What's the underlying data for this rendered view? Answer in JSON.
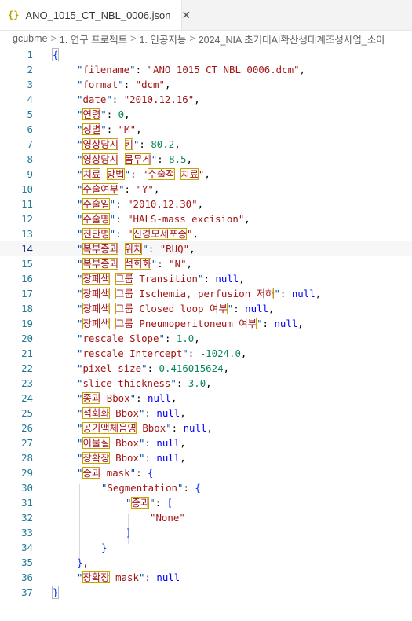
{
  "tab": {
    "icon": "{}",
    "title": "ANO_1015_CT_NBL_0006.json",
    "close": "✕"
  },
  "breadcrumb": [
    "gcubme",
    "1. 연구 프로젝트",
    "1. 인공지능",
    "2024_NIA 초거대AI확산생태계조성사업_소아"
  ],
  "breadcrumb_sep": ">",
  "active_line": 14,
  "lines": [
    {
      "n": "1",
      "indent": 0,
      "parts": [
        [
          "brace",
          "{"
        ]
      ]
    },
    {
      "n": "2",
      "indent": 1,
      "parts": [
        [
          "k",
          "filename"
        ],
        [
          "p",
          ": "
        ],
        [
          "s",
          "\"ANO_1015_CT_NBL_0006.dcm\""
        ],
        [
          "p",
          ","
        ]
      ]
    },
    {
      "n": "3",
      "indent": 1,
      "parts": [
        [
          "k",
          "format"
        ],
        [
          "p",
          ": "
        ],
        [
          "s",
          "\"dcm\""
        ],
        [
          "p",
          ","
        ]
      ]
    },
    {
      "n": "4",
      "indent": 1,
      "parts": [
        [
          "k",
          "date"
        ],
        [
          "p",
          ": "
        ],
        [
          "s",
          "\"2010.12.16\""
        ],
        [
          "p",
          ","
        ]
      ]
    },
    {
      "n": "5",
      "indent": 1,
      "parts": [
        [
          "k",
          "연령"
        ],
        [
          "p",
          ": "
        ],
        [
          "n",
          "0"
        ],
        [
          "p",
          ","
        ]
      ]
    },
    {
      "n": "6",
      "indent": 1,
      "parts": [
        [
          "k",
          "성별"
        ],
        [
          "p",
          ": "
        ],
        [
          "s",
          "\"M\""
        ],
        [
          "p",
          ","
        ]
      ]
    },
    {
      "n": "7",
      "indent": 1,
      "parts": [
        [
          "k",
          "영상당시 키"
        ],
        [
          "p",
          ": "
        ],
        [
          "n",
          "80.2"
        ],
        [
          "p",
          ","
        ]
      ]
    },
    {
      "n": "8",
      "indent": 1,
      "parts": [
        [
          "k",
          "영상당시 몸무게"
        ],
        [
          "p",
          ": "
        ],
        [
          "n",
          "8.5"
        ],
        [
          "p",
          ","
        ]
      ]
    },
    {
      "n": "9",
      "indent": 1,
      "parts": [
        [
          "k",
          "치료 방법"
        ],
        [
          "p",
          ": "
        ],
        [
          "s",
          "\"수술적 치료\""
        ],
        [
          "p",
          ","
        ]
      ]
    },
    {
      "n": "10",
      "indent": 1,
      "parts": [
        [
          "k",
          "수술여부"
        ],
        [
          "p",
          ": "
        ],
        [
          "s",
          "\"Y\""
        ],
        [
          "p",
          ","
        ]
      ]
    },
    {
      "n": "11",
      "indent": 1,
      "parts": [
        [
          "k",
          "수술일"
        ],
        [
          "p",
          ": "
        ],
        [
          "s",
          "\"2010.12.30\""
        ],
        [
          "p",
          ","
        ]
      ]
    },
    {
      "n": "12",
      "indent": 1,
      "parts": [
        [
          "k",
          "수술명"
        ],
        [
          "p",
          ": "
        ],
        [
          "s",
          "\"HALS-mass excision\""
        ],
        [
          "p",
          ","
        ]
      ]
    },
    {
      "n": "13",
      "indent": 1,
      "parts": [
        [
          "k",
          "진단명"
        ],
        [
          "p",
          ": "
        ],
        [
          "s",
          "\"신경모세포종\""
        ],
        [
          "p",
          ","
        ]
      ]
    },
    {
      "n": "14",
      "indent": 1,
      "parts": [
        [
          "k",
          "복부종괴 위치"
        ],
        [
          "p",
          ": "
        ],
        [
          "s",
          "\"RUQ\""
        ],
        [
          "p",
          ","
        ]
      ]
    },
    {
      "n": "15",
      "indent": 1,
      "parts": [
        [
          "k",
          "복부종괴 석회화"
        ],
        [
          "p",
          ": "
        ],
        [
          "s",
          "\"N\""
        ],
        [
          "p",
          ","
        ]
      ]
    },
    {
      "n": "16",
      "indent": 1,
      "parts": [
        [
          "k",
          "장폐색 그룹 Transition"
        ],
        [
          "p",
          ": "
        ],
        [
          "kw",
          "null"
        ],
        [
          "p",
          ","
        ]
      ]
    },
    {
      "n": "17",
      "indent": 1,
      "parts": [
        [
          "k",
          "장폐색 그룹 Ischemia, perfusion 저하"
        ],
        [
          "p",
          ": "
        ],
        [
          "kw",
          "null"
        ],
        [
          "p",
          ","
        ]
      ]
    },
    {
      "n": "18",
      "indent": 1,
      "parts": [
        [
          "k",
          "장폐색 그룹 Closed loop 여부"
        ],
        [
          "p",
          ": "
        ],
        [
          "kw",
          "null"
        ],
        [
          "p",
          ","
        ]
      ]
    },
    {
      "n": "19",
      "indent": 1,
      "parts": [
        [
          "k",
          "장폐색 그룹 Pneumoperitoneum 여부"
        ],
        [
          "p",
          ": "
        ],
        [
          "kw",
          "null"
        ],
        [
          "p",
          ","
        ]
      ]
    },
    {
      "n": "20",
      "indent": 1,
      "parts": [
        [
          "k",
          "rescale Slope"
        ],
        [
          "p",
          ": "
        ],
        [
          "n",
          "1.0"
        ],
        [
          "p",
          ","
        ]
      ]
    },
    {
      "n": "21",
      "indent": 1,
      "parts": [
        [
          "k",
          "rescale Intercept"
        ],
        [
          "p",
          ": "
        ],
        [
          "n",
          "-1024.0"
        ],
        [
          "p",
          ","
        ]
      ]
    },
    {
      "n": "22",
      "indent": 1,
      "parts": [
        [
          "k",
          "pixel size"
        ],
        [
          "p",
          ": "
        ],
        [
          "n",
          "0.416015624"
        ],
        [
          "p",
          ","
        ]
      ]
    },
    {
      "n": "23",
      "indent": 1,
      "parts": [
        [
          "k",
          "slice thickness"
        ],
        [
          "p",
          ": "
        ],
        [
          "n",
          "3.0"
        ],
        [
          "p",
          ","
        ]
      ]
    },
    {
      "n": "24",
      "indent": 1,
      "parts": [
        [
          "k",
          "종괴 Bbox"
        ],
        [
          "p",
          ": "
        ],
        [
          "kw",
          "null"
        ],
        [
          "p",
          ","
        ]
      ]
    },
    {
      "n": "25",
      "indent": 1,
      "parts": [
        [
          "k",
          "석회화 Bbox"
        ],
        [
          "p",
          ": "
        ],
        [
          "kw",
          "null"
        ],
        [
          "p",
          ","
        ]
      ]
    },
    {
      "n": "26",
      "indent": 1,
      "parts": [
        [
          "k",
          "공기액체음영 Bbox"
        ],
        [
          "p",
          ": "
        ],
        [
          "kw",
          "null"
        ],
        [
          "p",
          ","
        ]
      ]
    },
    {
      "n": "27",
      "indent": 1,
      "parts": [
        [
          "k",
          "이물질 Bbox"
        ],
        [
          "p",
          ": "
        ],
        [
          "kw",
          "null"
        ],
        [
          "p",
          ","
        ]
      ]
    },
    {
      "n": "28",
      "indent": 1,
      "parts": [
        [
          "k",
          "장확장 Bbox"
        ],
        [
          "p",
          ": "
        ],
        [
          "kw",
          "null"
        ],
        [
          "p",
          ","
        ]
      ]
    },
    {
      "n": "29",
      "indent": 1,
      "parts": [
        [
          "k",
          "종괴 mask"
        ],
        [
          "p",
          ": "
        ],
        [
          "brace",
          "{"
        ]
      ]
    },
    {
      "n": "30",
      "indent": 2,
      "parts": [
        [
          "k",
          "Segmentation"
        ],
        [
          "p",
          ": "
        ],
        [
          "brace",
          "{"
        ]
      ]
    },
    {
      "n": "31",
      "indent": 3,
      "parts": [
        [
          "k",
          "종괴"
        ],
        [
          "p",
          ": "
        ],
        [
          "brace",
          "["
        ]
      ]
    },
    {
      "n": "32",
      "indent": 4,
      "parts": [
        [
          "s",
          "\"None\""
        ]
      ]
    },
    {
      "n": "33",
      "indent": 3,
      "parts": [
        [
          "brace",
          "]"
        ]
      ]
    },
    {
      "n": "34",
      "indent": 2,
      "parts": [
        [
          "brace",
          "}"
        ]
      ]
    },
    {
      "n": "35",
      "indent": 1,
      "parts": [
        [
          "brace",
          "}"
        ],
        [
          "p",
          ","
        ]
      ]
    },
    {
      "n": "36",
      "indent": 1,
      "parts": [
        [
          "k",
          "장확장 mask"
        ],
        [
          "p",
          ": "
        ],
        [
          "kw",
          "null"
        ]
      ]
    },
    {
      "n": "37",
      "indent": 0,
      "parts": [
        [
          "brace",
          "}"
        ]
      ]
    }
  ],
  "colors": {
    "key": "#a31515",
    "string": "#a31515",
    "number": "#098658",
    "keyword": "#0000ff",
    "bracket": "#0431fa",
    "line_number": "#237893",
    "unicode_highlight": "#c9a100"
  }
}
